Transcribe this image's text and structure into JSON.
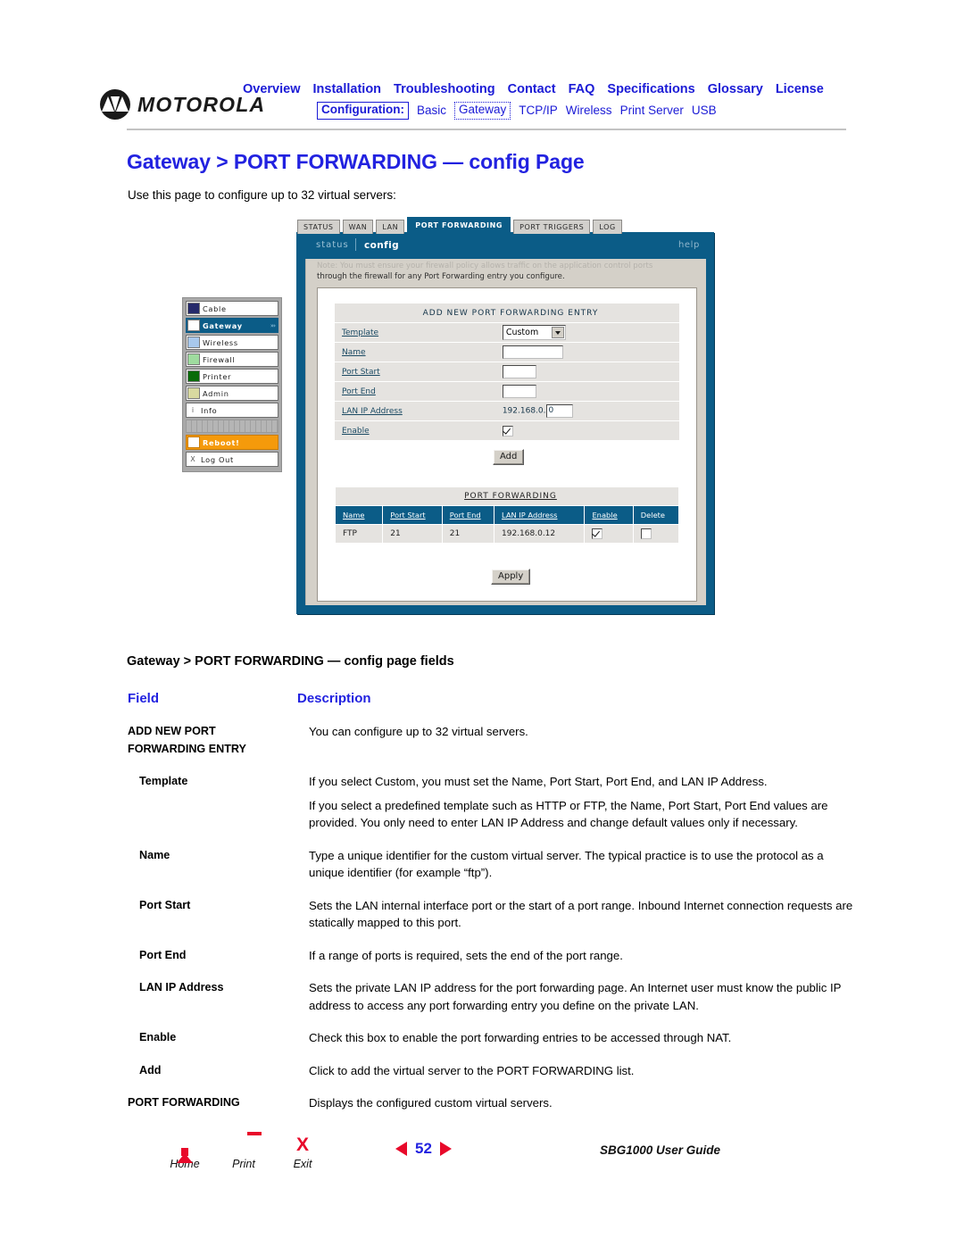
{
  "header": {
    "brand": "MOTOROLA",
    "nav_top": [
      "Overview",
      "Installation",
      "Troubleshooting",
      "Contact",
      "FAQ",
      "Specifications",
      "Glossary",
      "License"
    ],
    "config_label": "Configuration:",
    "nav_sub": [
      "Basic",
      "Gateway",
      "TCP/IP",
      "Wireless",
      "Print Server",
      "USB"
    ],
    "nav_sub_active": "Gateway"
  },
  "page": {
    "title": "Gateway > PORT FORWARDING — config Page",
    "intro": "Use this page to configure up to 32 virtual servers:"
  },
  "screenshot": {
    "tabs": [
      "STATUS",
      "WAN",
      "LAN",
      "PORT FORWARDING",
      "PORT TRIGGERS",
      "LOG"
    ],
    "active_tab": "PORT FORWARDING",
    "window_bar": {
      "status": "status",
      "config": "config",
      "help": "help"
    },
    "note_line1": "Note: You must ensure your firewall policy allows traffic on the application control ports",
    "note_line2": "through the firewall for any Port Forwarding entry you configure.",
    "sidebar": [
      {
        "label": "Cable",
        "color": "#262a6b"
      },
      {
        "label": "Gateway",
        "color": "#ffffff"
      },
      {
        "label": "Wireless",
        "color": "#a8c8ec"
      },
      {
        "label": "Firewall",
        "color": "#9fdc9f"
      },
      {
        "label": "Printer",
        "color": "#0a6b0a"
      },
      {
        "label": "Admin",
        "color": "#d8d9a0"
      }
    ],
    "sidebar_info": {
      "label": "Info",
      "icon": "i"
    },
    "sidebar_reboot": {
      "label": "Reboot!"
    },
    "sidebar_logout": {
      "label": "Log Out",
      "icon": "X"
    },
    "add_entry": {
      "caption": "ADD NEW PORT FORWARDING ENTRY",
      "rows": [
        {
          "label": "Template",
          "type": "select",
          "value": "Custom"
        },
        {
          "label": "Name",
          "type": "text",
          "value": ""
        },
        {
          "label": "Port Start",
          "type": "text",
          "value": ""
        },
        {
          "label": "Port End",
          "type": "text",
          "value": ""
        },
        {
          "label": "LAN IP Address",
          "type": "ip",
          "prefix": "192.168.0.",
          "value": "0"
        },
        {
          "label": "Enable",
          "type": "checkbox",
          "checked": true
        }
      ],
      "add_button": "Add"
    },
    "forward_table": {
      "caption": "PORT FORWARDING",
      "columns": [
        "Name",
        "Port Start",
        "Port End",
        "LAN IP Address",
        "Enable",
        "Delete"
      ],
      "rows": [
        {
          "name": "FTP",
          "port_start": "21",
          "port_end": "21",
          "lan_ip": "192.168.0.12",
          "enable": true,
          "delete": false
        }
      ],
      "apply_button": "Apply"
    }
  },
  "fields_section": {
    "title": "Gateway > PORT FORWARDING — config page fields",
    "col_field": "Field",
    "col_description": "Description",
    "rows": [
      {
        "field": "ADD NEW PORT FORWARDING ENTRY",
        "indent": false,
        "paragraphs": [
          "You can configure up to 32 virtual servers."
        ]
      },
      {
        "field": "Template",
        "indent": true,
        "paragraphs": [
          "If you select Custom,  you must set the Name, Port Start, Port End, and LAN IP Address.",
          "If you select a predefined template such as HTTP or FTP, the Name, Port Start, Port End values are provided. You only need to enter LAN IP Address and change default values only if necessary."
        ]
      },
      {
        "field": "Name",
        "indent": true,
        "paragraphs": [
          "Type a unique identifier for the custom virtual server. The typical practice is to use the protocol as a unique identifier (for example “ftp”)."
        ]
      },
      {
        "field": "Port Start",
        "indent": true,
        "paragraphs": [
          "Sets the LAN internal interface port or the start of a port range. Inbound Internet connection requests are statically mapped to this port."
        ]
      },
      {
        "field": "Port End",
        "indent": true,
        "paragraphs": [
          "If a range of ports is required, sets the end of the port range."
        ]
      },
      {
        "field": "LAN IP Address",
        "indent": true,
        "paragraphs": [
          "Sets the private LAN IP address for the port forwarding page. An Internet user must know the public IP address to access any port forwarding entry you define on the private LAN."
        ]
      },
      {
        "field": "Enable",
        "indent": true,
        "paragraphs": [
          "Check this box to enable the port forwarding entries to be accessed through NAT."
        ]
      },
      {
        "field": "Add",
        "indent": true,
        "paragraphs": [
          "Click to add the virtual server to the PORT FORWARDING list."
        ]
      },
      {
        "field": "PORT FORWARDING",
        "indent": false,
        "paragraphs": [
          "Displays the configured custom virtual servers."
        ]
      }
    ]
  },
  "footer": {
    "home": "Home",
    "print": "Print",
    "exit": "Exit",
    "exit_glyph": "X",
    "page_number": "52",
    "guide": "SBG1000 User Guide"
  },
  "colors": {
    "link_blue": "#1b1bd6",
    "title_blue": "#2222e0",
    "panel_blue": "#0b5c87",
    "accent_red": "#e8092a",
    "reboot_orange": "#f59a0b"
  }
}
